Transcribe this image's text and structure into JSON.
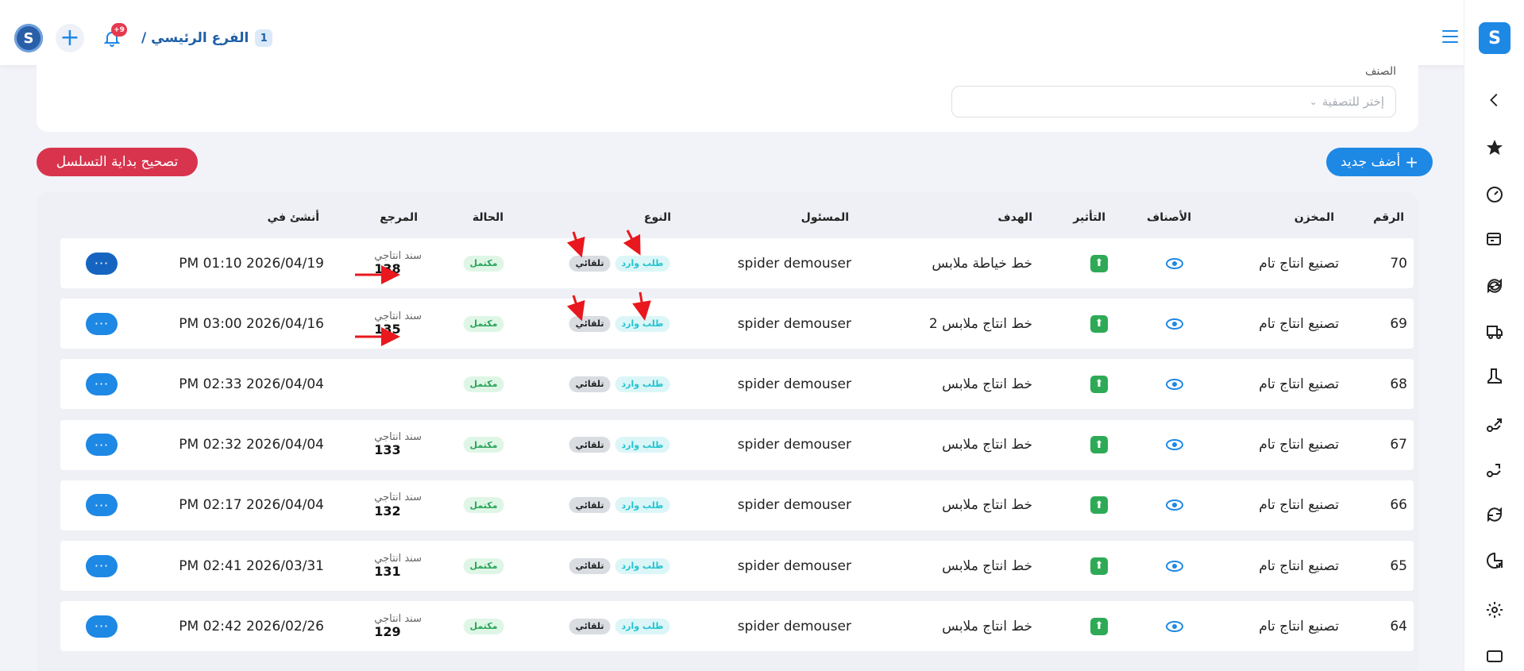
{
  "header": {
    "branch_label": "الفرع الرئيسي /",
    "branch_number": "1",
    "notification_count": "+9"
  },
  "filter": {
    "label": "الصنف",
    "placeholder": "إختر للتصفية"
  },
  "buttons": {
    "fix_sequence": "تصحيح بداية التسلسل",
    "add_new": "أضف جديد"
  },
  "table": {
    "headers": {
      "number": "الرقم",
      "warehouse": "المخزن",
      "items": "الأصناف",
      "effect": "التأثير",
      "target": "الهدف",
      "responsible": "المسئول",
      "type": "النوع",
      "status": "الحالة",
      "reference": "المرجع",
      "created_at": "أنشئ في"
    },
    "rows": [
      {
        "number": "70",
        "warehouse": "تصنيع انتاج تام",
        "target": "خط خياطة ملابس",
        "responsible": "spider demouser",
        "type": "طلب وارد",
        "mode": "تلقائي",
        "status": "مكتمل",
        "ref_label": "سند انتاجي",
        "ref_number": "138",
        "created_at": "PM 01:10 2026/04/19"
      },
      {
        "number": "69",
        "warehouse": "تصنيع انتاج تام",
        "target": "خط انتاج ملابس 2",
        "responsible": "spider demouser",
        "type": "طلب وارد",
        "mode": "تلقائي",
        "status": "مكتمل",
        "ref_label": "سند انتاجي",
        "ref_number": "135",
        "created_at": "PM 03:00 2026/04/16"
      },
      {
        "number": "68",
        "warehouse": "تصنيع انتاج تام",
        "target": "خط انتاج ملابس",
        "responsible": "spider demouser",
        "type": "طلب وارد",
        "mode": "تلقائي",
        "status": "مكتمل",
        "ref_label": "",
        "ref_number": "",
        "created_at": "PM 02:33 2026/04/04"
      },
      {
        "number": "67",
        "warehouse": "تصنيع انتاج تام",
        "target": "خط انتاج ملابس",
        "responsible": "spider demouser",
        "type": "طلب وارد",
        "mode": "تلقائي",
        "status": "مكتمل",
        "ref_label": "سند انتاجي",
        "ref_number": "133",
        "created_at": "PM 02:32 2026/04/04"
      },
      {
        "number": "66",
        "warehouse": "تصنيع انتاج تام",
        "target": "خط انتاج ملابس",
        "responsible": "spider demouser",
        "type": "طلب وارد",
        "mode": "تلقائي",
        "status": "مكتمل",
        "ref_label": "سند انتاجي",
        "ref_number": "132",
        "created_at": "PM 02:17 2026/04/04"
      },
      {
        "number": "65",
        "warehouse": "تصنيع انتاج تام",
        "target": "خط انتاج ملابس",
        "responsible": "spider demouser",
        "type": "طلب وارد",
        "mode": "تلقائي",
        "status": "مكتمل",
        "ref_label": "سند انتاجي",
        "ref_number": "131",
        "created_at": "PM 02:41 2026/03/31"
      },
      {
        "number": "64",
        "warehouse": "تصنيع انتاج تام",
        "target": "خط انتاج ملابس",
        "responsible": "spider demouser",
        "type": "طلب وارد",
        "mode": "تلقائي",
        "status": "مكتمل",
        "ref_label": "سند انتاجي",
        "ref_number": "129",
        "created_at": "PM 02:42 2026/02/26"
      }
    ]
  },
  "icons": {
    "rail": [
      "chevron-left-icon",
      "star-icon",
      "dashboard-gauge-icon",
      "register-icon",
      "sync-icon",
      "truck-icon",
      "boot-icon",
      "transfer-out-icon",
      "transfer-in-icon",
      "refresh-icon",
      "report-chart-icon",
      "settings-gear-icon",
      "window-icon"
    ]
  },
  "colors": {
    "primary": "#1e88e5",
    "danger": "#d8344d",
    "success": "#25a456",
    "accent_cyan": "#22c3cf",
    "annotation_arrow": "#e8181e"
  }
}
